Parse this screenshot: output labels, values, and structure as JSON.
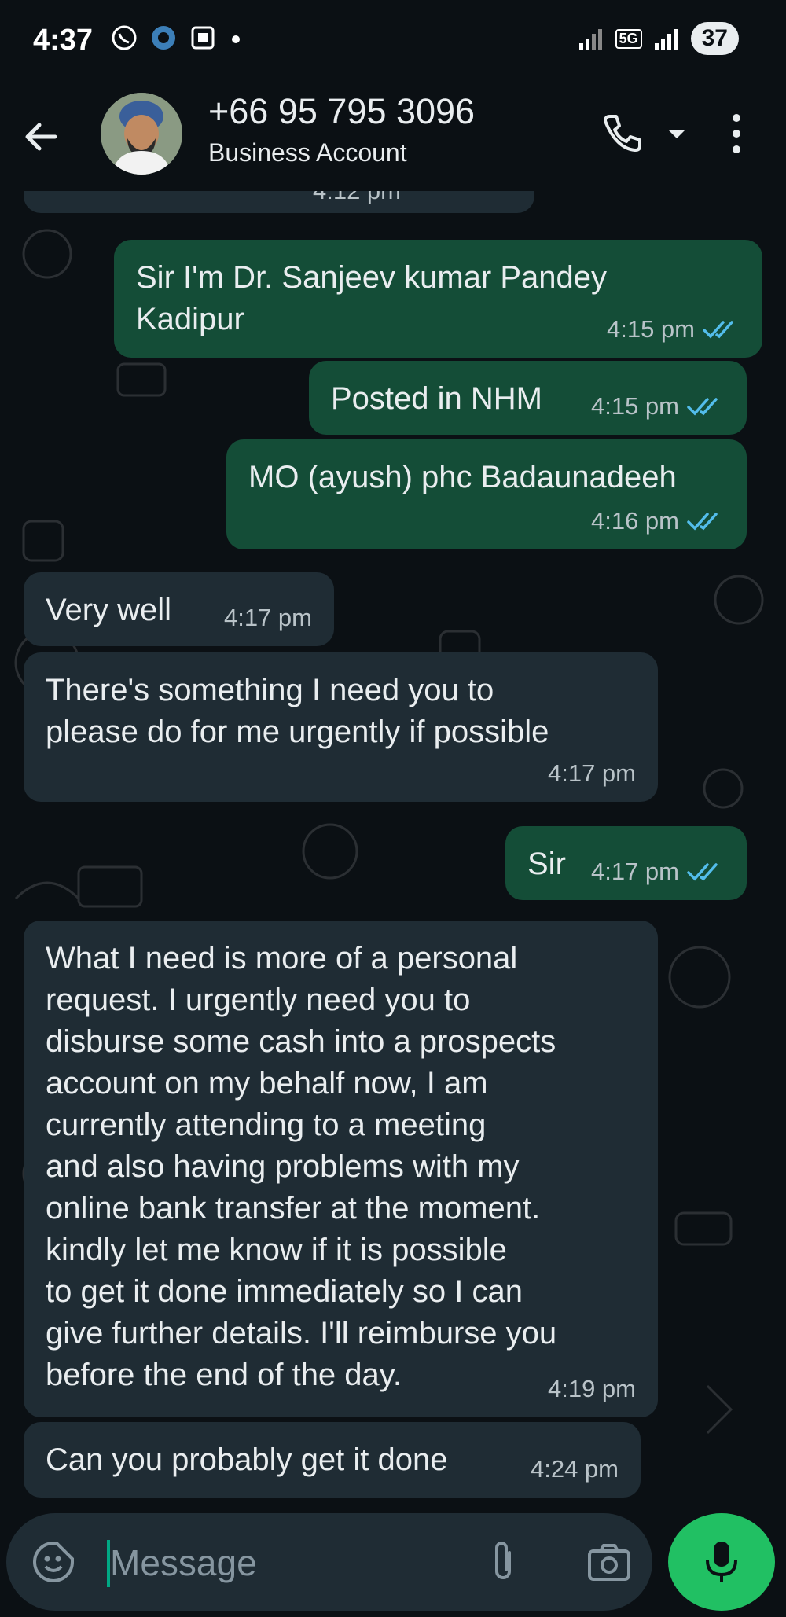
{
  "status_bar": {
    "time": "4:37",
    "network": "5G",
    "battery": "37"
  },
  "header": {
    "contact_name": "+66 95 795 3096",
    "subtitle": "Business Account"
  },
  "messages": [
    {
      "direction": "in",
      "text": "",
      "time": "4:12 pm"
    },
    {
      "direction": "out",
      "text": "Sir I'm Dr. Sanjeev kumar Pandey\nKadipur",
      "time": "4:15 pm",
      "read": true
    },
    {
      "direction": "out",
      "text": "Posted in NHM",
      "time": "4:15 pm",
      "read": true
    },
    {
      "direction": "out",
      "text": "MO (ayush) phc Badaunadeeh",
      "time": "4:16 pm",
      "read": true
    },
    {
      "direction": "in",
      "text": "Very well",
      "time": "4:17 pm"
    },
    {
      "direction": "in",
      "text": "There's something I need you to\nplease do for me urgently if possible",
      "time": "4:17 pm"
    },
    {
      "direction": "out",
      "text": "Sir",
      "time": "4:17 pm",
      "read": true
    },
    {
      "direction": "in",
      "text": "What I need is more of a personal\nrequest. I urgently need you to\ndisburse some cash into a prospects\naccount on my behalf now, I am\ncurrently attending to a meeting\nand also having problems with my\nonline bank transfer at the moment.\nkindly let me know if it is possible\nto get it done immediately so I can\ngive further details. I'll reimburse you\nbefore the end of the day.",
      "time": "4:19 pm"
    },
    {
      "direction": "in",
      "text": "Can you probably get it done",
      "time": "4:24 pm"
    }
  ],
  "composer": {
    "placeholder": "Message"
  },
  "colors": {
    "background": "#0b1014",
    "outgoing_bubble": "#144d37",
    "incoming_bubble": "#1f2c34",
    "read_ticks": "#53bdeb",
    "mic_button": "#21c063"
  }
}
